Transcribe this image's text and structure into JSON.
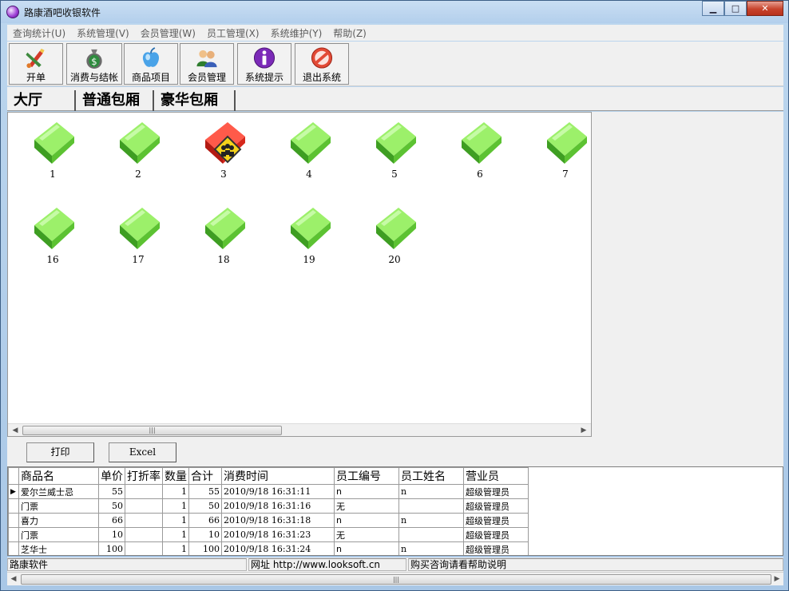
{
  "window": {
    "title": "路康酒吧收银软件",
    "minimize": "▁",
    "maximize": "□",
    "close": "✕"
  },
  "menu": [
    "查询统计(U)",
    "系统管理(V)",
    "会员管理(W)",
    "员工管理(X)",
    "系统维护(Y)",
    "帮助(Z)"
  ],
  "toolbar": [
    {
      "label": "开单",
      "icon": "brush-pencil-icon"
    },
    {
      "label": "消费与结帐",
      "icon": "money-bag-icon"
    },
    {
      "label": "商品项目",
      "icon": "apple-icon"
    },
    {
      "label": "会员管理",
      "icon": "users-icon"
    },
    {
      "label": "系统提示",
      "icon": "info-icon"
    },
    {
      "label": "退出系统",
      "icon": "no-entry-icon"
    }
  ],
  "tabs": [
    "大厅",
    "普通包厢",
    "豪华包厢"
  ],
  "rooms": [
    {
      "num": "1",
      "status": "free"
    },
    {
      "num": "2",
      "status": "free"
    },
    {
      "num": "3",
      "status": "occupied"
    },
    {
      "num": "4",
      "status": "free"
    },
    {
      "num": "5",
      "status": "free"
    },
    {
      "num": "6",
      "status": "free"
    },
    {
      "num": "7",
      "status": "free"
    },
    {
      "num": "16",
      "status": "free"
    },
    {
      "num": "17",
      "status": "free"
    },
    {
      "num": "18",
      "status": "free"
    },
    {
      "num": "19",
      "status": "free"
    },
    {
      "num": "20",
      "status": "free"
    }
  ],
  "actions": {
    "print": "打印",
    "excel": "Excel"
  },
  "scroll_grip": "|||",
  "grid": {
    "columns": [
      "商品名",
      "单价",
      "打折率",
      "数量",
      "合计",
      "消费时间",
      "员工编号",
      "员工姓名",
      "营业员"
    ],
    "rows": [
      [
        "爱尔兰威士忌",
        "55",
        "",
        "1",
        "55",
        "2010/9/18  16:31:11",
        "n",
        "n",
        "超级管理员"
      ],
      [
        "门票",
        "50",
        "",
        "1",
        "50",
        "2010/9/18  16:31:16",
        "无",
        "",
        "超级管理员"
      ],
      [
        "喜力",
        "66",
        "",
        "1",
        "66",
        "2010/9/18  16:31:18",
        "n",
        "n",
        "超级管理员"
      ],
      [
        "门票",
        "10",
        "",
        "1",
        "10",
        "2010/9/18  16:31:23",
        "无",
        "",
        "超级管理员"
      ],
      [
        "芝华士",
        "100",
        "",
        "1",
        "100",
        "2010/9/18  16:31:24",
        "n",
        "n",
        "超级管理员"
      ]
    ],
    "row_marker": "▶"
  },
  "status": {
    "left": "路康软件",
    "middle": "网址 http://www.looksoft.cn",
    "right": "购买咨询请看帮助说明"
  }
}
